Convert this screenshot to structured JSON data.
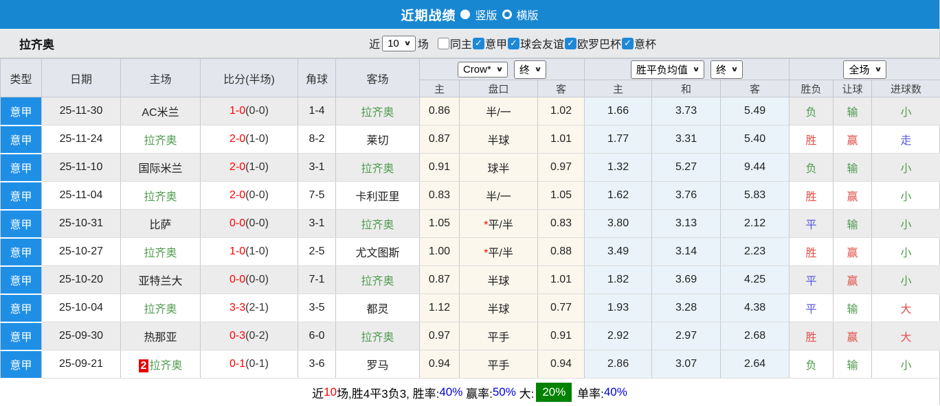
{
  "colors": {
    "topbar_blue": "#1787d2",
    "league_cell_blue": "#1f8fe6",
    "focus_team_green": "#4e9b4e",
    "win_red": "#e0504a",
    "draw_blue": "#5a5ae0",
    "score_red": "#fe0000",
    "pct_blue": "#0000dd",
    "big_rate_badge_green": "#028102",
    "odds_col_bg": "#fbf7ec",
    "avg_col_bg": "#e9f3f9"
  },
  "titlebar": {
    "title": "近期战绩",
    "vertical_label": "竖版",
    "horizontal_label": "横版"
  },
  "filterbar": {
    "team": "拉齐奥",
    "near_label": "近",
    "match_count": "10",
    "matches_label": "场",
    "checkboxes": [
      {
        "label": "同主",
        "state": "off"
      },
      {
        "label": "意甲",
        "state": "on"
      },
      {
        "label": "球会友谊",
        "state": "on"
      },
      {
        "label": "欧罗巴杯",
        "state": "on"
      },
      {
        "label": "意杯",
        "state": "on"
      }
    ]
  },
  "table": {
    "selects": {
      "odds_source": "Crow*",
      "odds_state": "终",
      "avg_type": "胜平负均值",
      "avg_state": "终",
      "scope": "全场"
    },
    "headers": {
      "type": "类型",
      "date": "日期",
      "home": "主场",
      "score": "比分(半场)",
      "corner": "角球",
      "away": "客场",
      "odds_home": "主",
      "odds_handicap": "盘口",
      "odds_away": "客",
      "avg_home": "主",
      "avg_draw": "和",
      "avg_away": "客",
      "result_spf": "胜负",
      "result_handicap": "让球",
      "result_goals": "进球数"
    },
    "rows": [
      {
        "league": "意甲",
        "date": "25-11-30",
        "home": "AC米兰",
        "home_cls": "",
        "home_badge": "",
        "score": "1-0",
        "half": "(0-0)",
        "corner": "1-4",
        "away": "拉齐奥",
        "away_cls": "focus",
        "odds_home": "0.86",
        "handicap_star": "",
        "handicap": "半/一",
        "odds_away": "1.02",
        "avg_home": "1.66",
        "avg_draw": "3.73",
        "avg_away": "5.49",
        "spf": "负",
        "spf_cls": "g",
        "rq": "输",
        "rq_cls": "g",
        "jq": "小",
        "jq_cls": "g"
      },
      {
        "league": "意甲",
        "date": "25-11-24",
        "home": "拉齐奥",
        "home_cls": "focus",
        "home_badge": "",
        "score": "2-0",
        "half": "(1-0)",
        "corner": "8-2",
        "away": "莱切",
        "away_cls": "",
        "odds_home": "0.87",
        "handicap_star": "",
        "handicap": "半球",
        "odds_away": "1.01",
        "avg_home": "1.77",
        "avg_draw": "3.31",
        "avg_away": "5.40",
        "spf": "胜",
        "spf_cls": "r",
        "rq": "赢",
        "rq_cls": "r",
        "jq": "走",
        "jq_cls": "b"
      },
      {
        "league": "意甲",
        "date": "25-11-10",
        "home": "国际米兰",
        "home_cls": "",
        "home_badge": "",
        "score": "2-0",
        "half": "(1-0)",
        "corner": "3-1",
        "away": "拉齐奥",
        "away_cls": "focus",
        "odds_home": "0.91",
        "handicap_star": "",
        "handicap": "球半",
        "odds_away": "0.97",
        "avg_home": "1.32",
        "avg_draw": "5.27",
        "avg_away": "9.44",
        "spf": "负",
        "spf_cls": "g",
        "rq": "输",
        "rq_cls": "g",
        "jq": "小",
        "jq_cls": "g"
      },
      {
        "league": "意甲",
        "date": "25-11-04",
        "home": "拉齐奥",
        "home_cls": "focus",
        "home_badge": "",
        "score": "2-0",
        "half": "(0-0)",
        "corner": "7-5",
        "away": "卡利亚里",
        "away_cls": "",
        "odds_home": "0.83",
        "handicap_star": "",
        "handicap": "半/一",
        "odds_away": "1.05",
        "avg_home": "1.62",
        "avg_draw": "3.76",
        "avg_away": "5.83",
        "spf": "胜",
        "spf_cls": "r",
        "rq": "赢",
        "rq_cls": "r",
        "jq": "小",
        "jq_cls": "g"
      },
      {
        "league": "意甲",
        "date": "25-10-31",
        "home": "比萨",
        "home_cls": "",
        "home_badge": "",
        "score": "0-0",
        "half": "(0-0)",
        "corner": "3-1",
        "away": "拉齐奥",
        "away_cls": "focus",
        "odds_home": "1.05",
        "handicap_star": "*",
        "handicap": "平/半",
        "odds_away": "0.83",
        "avg_home": "3.80",
        "avg_draw": "3.13",
        "avg_away": "2.12",
        "spf": "平",
        "spf_cls": "b",
        "rq": "输",
        "rq_cls": "g",
        "jq": "小",
        "jq_cls": "g"
      },
      {
        "league": "意甲",
        "date": "25-10-27",
        "home": "拉齐奥",
        "home_cls": "focus",
        "home_badge": "",
        "score": "1-0",
        "half": "(1-0)",
        "corner": "2-5",
        "away": "尤文图斯",
        "away_cls": "",
        "odds_home": "1.00",
        "handicap_star": "*",
        "handicap": "平/半",
        "odds_away": "0.88",
        "avg_home": "3.49",
        "avg_draw": "3.14",
        "avg_away": "2.23",
        "spf": "胜",
        "spf_cls": "r",
        "rq": "赢",
        "rq_cls": "r",
        "jq": "小",
        "jq_cls": "g"
      },
      {
        "league": "意甲",
        "date": "25-10-20",
        "home": "亚特兰大",
        "home_cls": "",
        "home_badge": "",
        "score": "0-0",
        "half": "(0-0)",
        "corner": "7-1",
        "away": "拉齐奥",
        "away_cls": "focus",
        "odds_home": "0.87",
        "handicap_star": "",
        "handicap": "半球",
        "odds_away": "1.01",
        "avg_home": "1.82",
        "avg_draw": "3.69",
        "avg_away": "4.25",
        "spf": "平",
        "spf_cls": "b",
        "rq": "赢",
        "rq_cls": "r",
        "jq": "小",
        "jq_cls": "g"
      },
      {
        "league": "意甲",
        "date": "25-10-04",
        "home": "拉齐奥",
        "home_cls": "focus",
        "home_badge": "",
        "score": "3-3",
        "half": "(2-1)",
        "corner": "3-5",
        "away": "都灵",
        "away_cls": "",
        "odds_home": "1.12",
        "handicap_star": "",
        "handicap": "半球",
        "odds_away": "0.77",
        "avg_home": "1.93",
        "avg_draw": "3.28",
        "avg_away": "4.38",
        "spf": "平",
        "spf_cls": "b",
        "rq": "输",
        "rq_cls": "g",
        "jq": "大",
        "jq_cls": "r"
      },
      {
        "league": "意甲",
        "date": "25-09-30",
        "home": "热那亚",
        "home_cls": "",
        "home_badge": "",
        "score": "0-3",
        "half": "(0-2)",
        "corner": "6-0",
        "away": "拉齐奥",
        "away_cls": "focus",
        "odds_home": "0.97",
        "handicap_star": "",
        "handicap": "平手",
        "odds_away": "0.91",
        "avg_home": "2.92",
        "avg_draw": "2.97",
        "avg_away": "2.68",
        "spf": "胜",
        "spf_cls": "r",
        "rq": "赢",
        "rq_cls": "r",
        "jq": "大",
        "jq_cls": "r"
      },
      {
        "league": "意甲",
        "date": "25-09-21",
        "home": "拉齐奥",
        "home_cls": "focus",
        "home_badge": "2",
        "score": "0-1",
        "half": "(0-1)",
        "corner": "3-6",
        "away": "罗马",
        "away_cls": "",
        "odds_home": "0.94",
        "handicap_star": "",
        "handicap": "平手",
        "odds_away": "0.94",
        "avg_home": "2.86",
        "avg_draw": "3.07",
        "avg_away": "2.64",
        "spf": "负",
        "spf_cls": "g",
        "rq": "输",
        "rq_cls": "g",
        "jq": "小",
        "jq_cls": "g"
      }
    ]
  },
  "summary": {
    "segments": [
      {
        "text": "近",
        "cls": ""
      },
      {
        "text": "10",
        "cls": "red"
      },
      {
        "text": "场,胜4平3负3, 胜率:",
        "cls": ""
      },
      {
        "text": "40%",
        "cls": "blue"
      },
      {
        "text": " 赢率:",
        "cls": ""
      },
      {
        "text": "50%",
        "cls": "blue"
      },
      {
        "text": " 大:",
        "cls": ""
      },
      {
        "text": "20%",
        "cls": "greenbadge"
      },
      {
        "text": " 单率:",
        "cls": ""
      },
      {
        "text": "40%",
        "cls": "blue"
      }
    ]
  }
}
